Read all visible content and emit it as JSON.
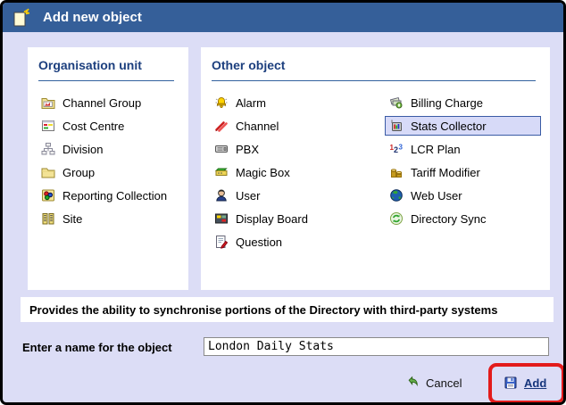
{
  "window": {
    "title": "Add new object",
    "icon": "new-object-icon"
  },
  "left_panel": {
    "heading": "Organisation unit",
    "items": [
      {
        "label": "Channel Group",
        "icon": "channel-group-icon"
      },
      {
        "label": "Cost Centre",
        "icon": "cost-centre-icon"
      },
      {
        "label": "Division",
        "icon": "division-icon"
      },
      {
        "label": "Group",
        "icon": "group-icon"
      },
      {
        "label": "Reporting Collection",
        "icon": "reporting-collection-icon"
      },
      {
        "label": "Site",
        "icon": "site-icon"
      }
    ]
  },
  "right_panel": {
    "heading": "Other object",
    "column1": [
      {
        "label": "Alarm",
        "icon": "alarm-icon"
      },
      {
        "label": "Channel",
        "icon": "channel-icon"
      },
      {
        "label": "PBX",
        "icon": "pbx-icon"
      },
      {
        "label": "Magic Box",
        "icon": "magic-box-icon"
      },
      {
        "label": "User",
        "icon": "user-icon"
      },
      {
        "label": "Display Board",
        "icon": "display-board-icon"
      },
      {
        "label": "Question",
        "icon": "question-icon"
      }
    ],
    "column2": [
      {
        "label": "Billing Charge",
        "icon": "billing-charge-icon"
      },
      {
        "label": "Stats Collector",
        "icon": "stats-collector-icon",
        "selected": true
      },
      {
        "label": "LCR Plan",
        "icon": "lcr-plan-icon"
      },
      {
        "label": "Tariff Modifier",
        "icon": "tariff-modifier-icon"
      },
      {
        "label": "Web User",
        "icon": "web-user-icon"
      },
      {
        "label": "Directory Sync",
        "icon": "directory-sync-icon"
      }
    ],
    "selected_item": "Stats Collector"
  },
  "description": {
    "text": "Provides the ability to synchronise portions of the Directory with third-party systems"
  },
  "name_form": {
    "label": "Enter a name for the object",
    "value": "London Daily Stats"
  },
  "actions": {
    "cancel_label": "Cancel",
    "add_label": "Add"
  },
  "colors": {
    "titlebar": "#355F99",
    "body_background": "#DCDDF6",
    "heading_text": "#1C3F7E",
    "selection_background": "#D7DAF8",
    "selection_border": "#3A5BA5",
    "add_link": "#16357C",
    "annotation_red": "#E31B1B"
  }
}
